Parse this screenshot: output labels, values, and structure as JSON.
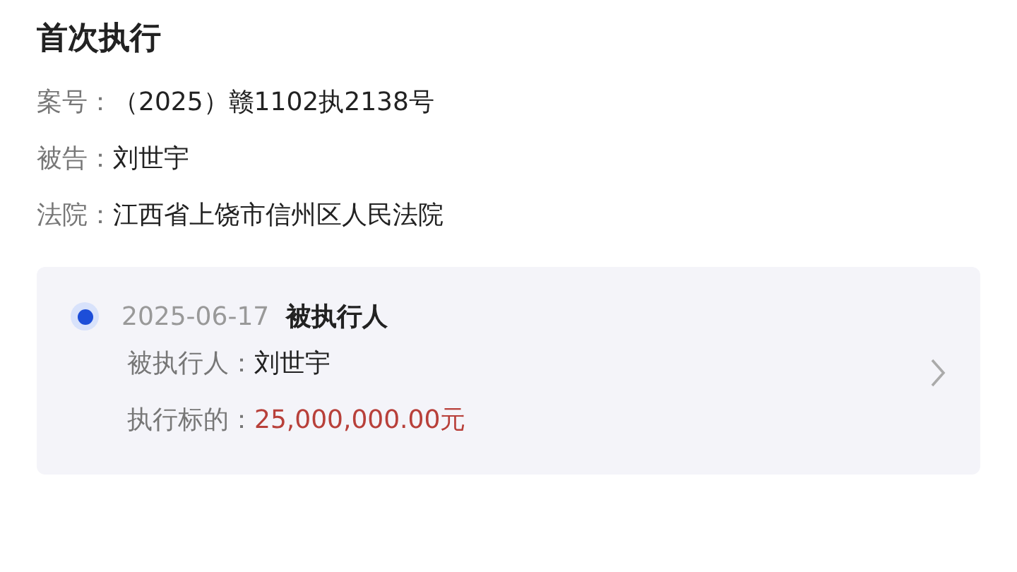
{
  "title": "首次执行",
  "fields": [
    {
      "label": "案号：",
      "value": "（2025）赣1102执2138号"
    },
    {
      "label": "被告：",
      "value": "刘世宇"
    },
    {
      "label": "法院：",
      "value": "江西省上饶市信州区人民法院"
    }
  ],
  "timeline": [
    {
      "date": "2025-06-17",
      "heading": "被执行人",
      "rows": [
        {
          "label": "被执行人：",
          "value": "刘世宇",
          "kind": "plain"
        },
        {
          "label": "执行标的：",
          "value": "25,000,000.00元",
          "kind": "amount"
        }
      ]
    }
  ]
}
